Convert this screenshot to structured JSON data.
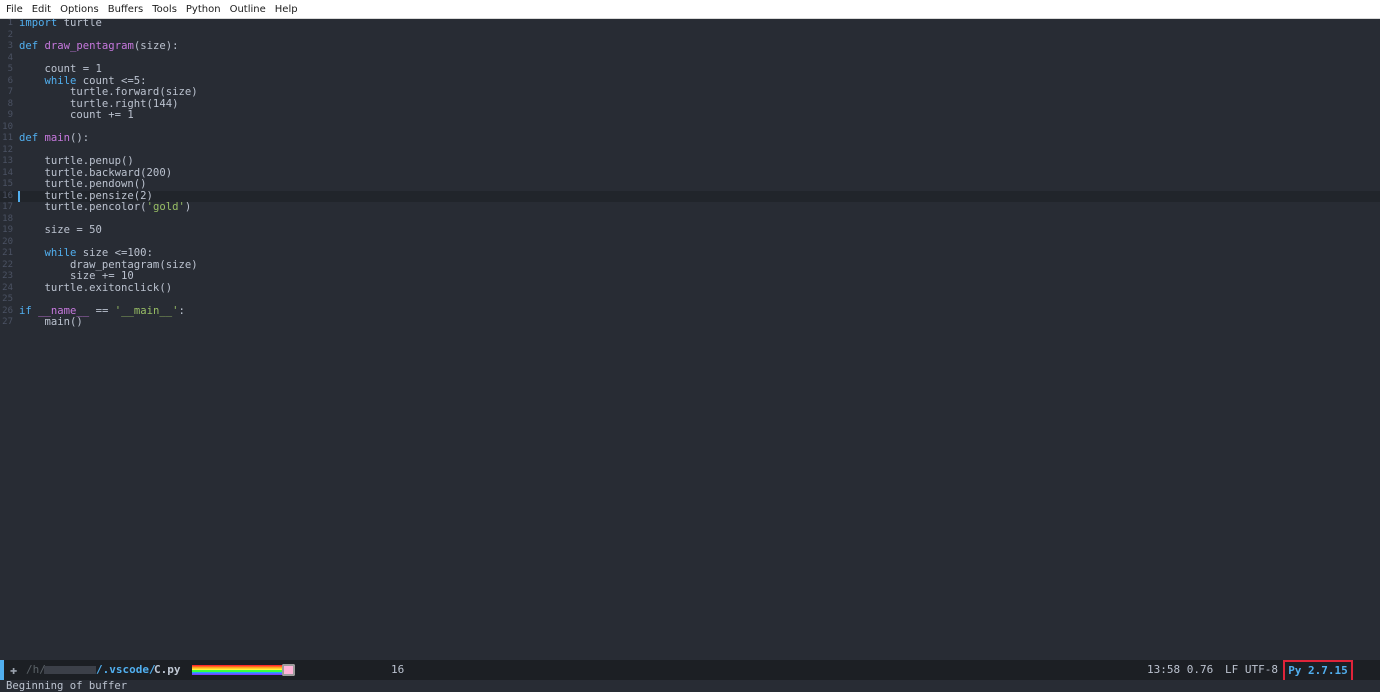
{
  "menubar": {
    "items": [
      "File",
      "Edit",
      "Options",
      "Buffers",
      "Tools",
      "Python",
      "Outline",
      "Help"
    ]
  },
  "editor": {
    "current_line": 16,
    "lines": [
      {
        "n": "1",
        "segs": [
          {
            "t": "import",
            "c": "kw"
          },
          {
            "t": " turtle",
            "c": ""
          }
        ]
      },
      {
        "n": "2",
        "segs": []
      },
      {
        "n": "3",
        "segs": [
          {
            "t": "def",
            "c": "kw"
          },
          {
            "t": " ",
            "c": ""
          },
          {
            "t": "draw_pentagram",
            "c": "fn"
          },
          {
            "t": "(size):",
            "c": ""
          }
        ]
      },
      {
        "n": "4",
        "segs": []
      },
      {
        "n": "5",
        "segs": [
          {
            "t": "    count = 1",
            "c": ""
          }
        ]
      },
      {
        "n": "6",
        "segs": [
          {
            "t": "    ",
            "c": ""
          },
          {
            "t": "while",
            "c": "kw"
          },
          {
            "t": " count <=5:",
            "c": ""
          }
        ]
      },
      {
        "n": "7",
        "segs": [
          {
            "t": "        turtle.forward(size)",
            "c": ""
          }
        ]
      },
      {
        "n": "8",
        "segs": [
          {
            "t": "        turtle.right(144)",
            "c": ""
          }
        ]
      },
      {
        "n": "9",
        "segs": [
          {
            "t": "        count += 1",
            "c": ""
          }
        ]
      },
      {
        "n": "10",
        "segs": []
      },
      {
        "n": "11",
        "segs": [
          {
            "t": "def",
            "c": "kw"
          },
          {
            "t": " ",
            "c": ""
          },
          {
            "t": "main",
            "c": "fn"
          },
          {
            "t": "():",
            "c": ""
          }
        ]
      },
      {
        "n": "12",
        "segs": []
      },
      {
        "n": "13",
        "segs": [
          {
            "t": "    turtle.penup()",
            "c": ""
          }
        ]
      },
      {
        "n": "14",
        "segs": [
          {
            "t": "    turtle.backward(200)",
            "c": ""
          }
        ]
      },
      {
        "n": "15",
        "segs": [
          {
            "t": "    turtle.pendown()",
            "c": ""
          }
        ]
      },
      {
        "n": "16",
        "segs": [
          {
            "t": "    turtle.pensize(2)",
            "c": ""
          }
        ]
      },
      {
        "n": "17",
        "segs": [
          {
            "t": "    turtle.pencolor(",
            "c": ""
          },
          {
            "t": "'gold'",
            "c": "str"
          },
          {
            "t": ")",
            "c": ""
          }
        ]
      },
      {
        "n": "18",
        "segs": []
      },
      {
        "n": "19",
        "segs": [
          {
            "t": "    size = 50",
            "c": ""
          }
        ]
      },
      {
        "n": "20",
        "segs": []
      },
      {
        "n": "21",
        "segs": [
          {
            "t": "    ",
            "c": ""
          },
          {
            "t": "while",
            "c": "kw"
          },
          {
            "t": " size <=100:",
            "c": ""
          }
        ]
      },
      {
        "n": "22",
        "segs": [
          {
            "t": "        draw_pentagram(size)",
            "c": ""
          }
        ]
      },
      {
        "n": "23",
        "segs": [
          {
            "t": "        size += 10",
            "c": ""
          }
        ]
      },
      {
        "n": "24",
        "segs": [
          {
            "t": "    turtle.exitonclick()",
            "c": ""
          }
        ]
      },
      {
        "n": "25",
        "segs": []
      },
      {
        "n": "26",
        "segs": [
          {
            "t": "if",
            "c": "kw"
          },
          {
            "t": " ",
            "c": ""
          },
          {
            "t": "__name__",
            "c": "var"
          },
          {
            "t": " == ",
            "c": ""
          },
          {
            "t": "'__main__'",
            "c": "str"
          },
          {
            "t": ":",
            "c": ""
          }
        ]
      },
      {
        "n": "27",
        "segs": [
          {
            "t": "    main()",
            "c": ""
          }
        ]
      }
    ]
  },
  "modeline": {
    "path_prefix": "/h/",
    "path_dir": "/.vscode/",
    "file_name": "C.py",
    "line_number": "16",
    "time_load": "13:58 0.76",
    "eol_encoding": "LF UTF-8",
    "python_version": "Py 2.7.15"
  },
  "echo": {
    "message": "Beginning of buffer"
  },
  "colors": {
    "background": "#282c34",
    "keyword": "#51afef",
    "function": "#c678dd",
    "string": "#98be65",
    "highlight_box": "#e0243a"
  }
}
